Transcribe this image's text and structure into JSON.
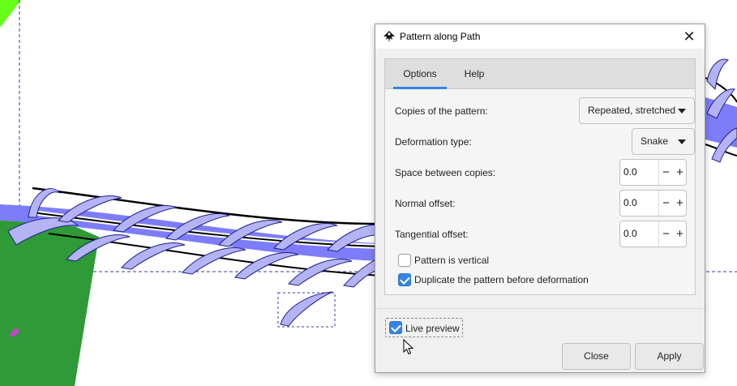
{
  "dialog": {
    "title": "Pattern along Path",
    "close_icon": "close-x",
    "tabs": [
      {
        "label": "Options",
        "active": true
      },
      {
        "label": "Help",
        "active": false
      }
    ],
    "copies_label": "Copies of the pattern:",
    "copies_value": "Repeated, stretched",
    "deformation_label": "Deformation type:",
    "deformation_value": "Snake",
    "space_label": "Space between copies:",
    "space_value": "0.0",
    "normal_label": "Normal offset:",
    "normal_value": "0.0",
    "tangential_label": "Tangential offset:",
    "tangential_value": "0.0",
    "minus_glyph": "−",
    "plus_glyph": "+",
    "vertical_label": "Pattern is vertical",
    "vertical_checked": false,
    "duplicate_label": "Duplicate the pattern before deformation",
    "duplicate_checked": true,
    "live_preview_label": "Live preview",
    "live_preview_checked": true,
    "close_button": "Close",
    "apply_button": "Apply"
  },
  "colors": {
    "accent": "#3584e4",
    "leaf_fill": "#b4b4f4",
    "leaf_stroke": "#1e1e8c",
    "band_blue": "#7d7dfa",
    "green_shape": "#2f9a37",
    "lime_corner": "#66ff1a",
    "guide_dash": "#3a3aa0"
  }
}
